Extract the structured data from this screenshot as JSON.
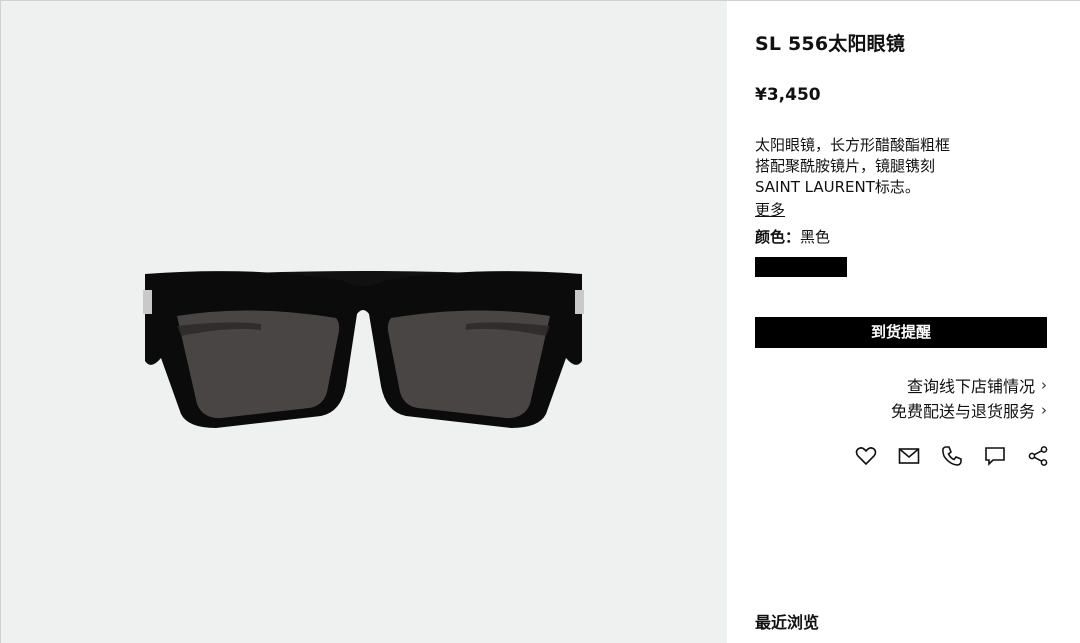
{
  "product": {
    "title": "SL 556太阳眼镜",
    "price": "¥3,450",
    "description_lines": [
      "太阳眼镜，长方形醋酸酯粗框",
      "搭配聚酰胺镜片，镜腿镌刻",
      "SAINT LAURENT标志。"
    ],
    "more_label": "更多",
    "color_label": "颜色：",
    "color_value": "黑色",
    "swatch_color": "#000000"
  },
  "actions": {
    "notify_label": "到货提醒",
    "store_link": "查询线下店铺情况",
    "delivery_link": "免费配送与退货服务"
  },
  "share_icons": [
    "heart-icon",
    "mail-icon",
    "phone-icon",
    "chat-icon",
    "share-icon"
  ],
  "recent": {
    "label": "最近浏览"
  },
  "colors": {
    "image_bg": "#eff1f0",
    "accent": "#000000"
  }
}
